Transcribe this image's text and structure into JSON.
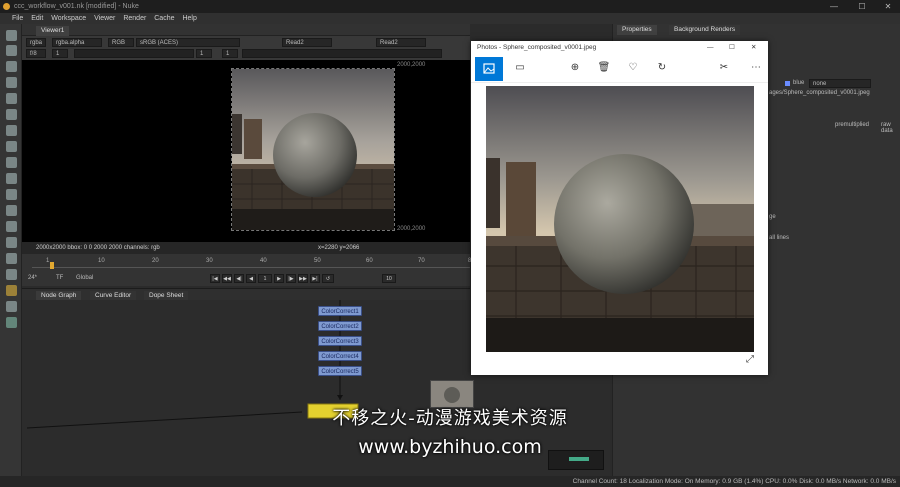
{
  "window": {
    "title": "ccc_workflow_v001.nk [modified] - Nuke",
    "min": "—",
    "max": "☐",
    "close": "✕"
  },
  "menu": [
    "File",
    "Edit",
    "Workspace",
    "Viewer",
    "Render",
    "Cache",
    "Help"
  ],
  "viewer": {
    "tab": "Viewer1",
    "channel": "rgba",
    "layer": "rgba.alpha",
    "mode": "RGB",
    "lut": "sRGB (ACES)",
    "input_a": "Read2",
    "input_b": "Read2",
    "fstop": "f/8",
    "frame_ratio": "1",
    "gain_value": "1",
    "gamma_value": "1",
    "coord_top": "2000,2000",
    "coord_bottom": "2000,2000",
    "info_left": "2000x2000  bbox: 0 0 2000 2000 channels: rgb",
    "info_center": "x=2280 y=2066"
  },
  "timeline": {
    "ticks": [
      "1",
      "10",
      "20",
      "30",
      "40",
      "50",
      "60",
      "70",
      "80"
    ],
    "fps": "24*",
    "tf": "TF",
    "global": "Global",
    "frame": "1",
    "step": "10"
  },
  "nodegraph": {
    "tabs": [
      "Node Graph",
      "Curve Editor",
      "Dope Sheet"
    ],
    "nodes": [
      "ColorCorrect1",
      "ColorCorrect2",
      "ColorCorrect3",
      "ColorCorrect4",
      "ColorCorrect5"
    ]
  },
  "properties": {
    "tabs": [
      "Properties",
      "Background Renders"
    ],
    "labels": [
      "blue",
      "none",
      "ages/Sphere_composited_v0001.jpeg",
      "premultiplied",
      "raw data",
      "ge",
      "all lines"
    ]
  },
  "photos": {
    "title": "Photos - Sphere_composited_v0001.jpeg",
    "min": "—",
    "max": "☐",
    "close": "✕",
    "toolbar": [
      "image-icon",
      "slideshow-icon",
      "zoom-icon",
      "delete-icon",
      "heart-icon",
      "rotate-icon",
      "edit-icon",
      "more-icon"
    ],
    "accent": "#0078d7"
  },
  "watermark": {
    "line1": "不移之火-动漫游戏美术资源",
    "line2": "www.byzhihuo.com"
  },
  "statusbar": "Channel Count: 18  Localization Mode: On  Memory: 0.9 GB (1.4%)  CPU: 0.0%  Disk: 0.0 MB/s  Network: 0.0 MB/s"
}
